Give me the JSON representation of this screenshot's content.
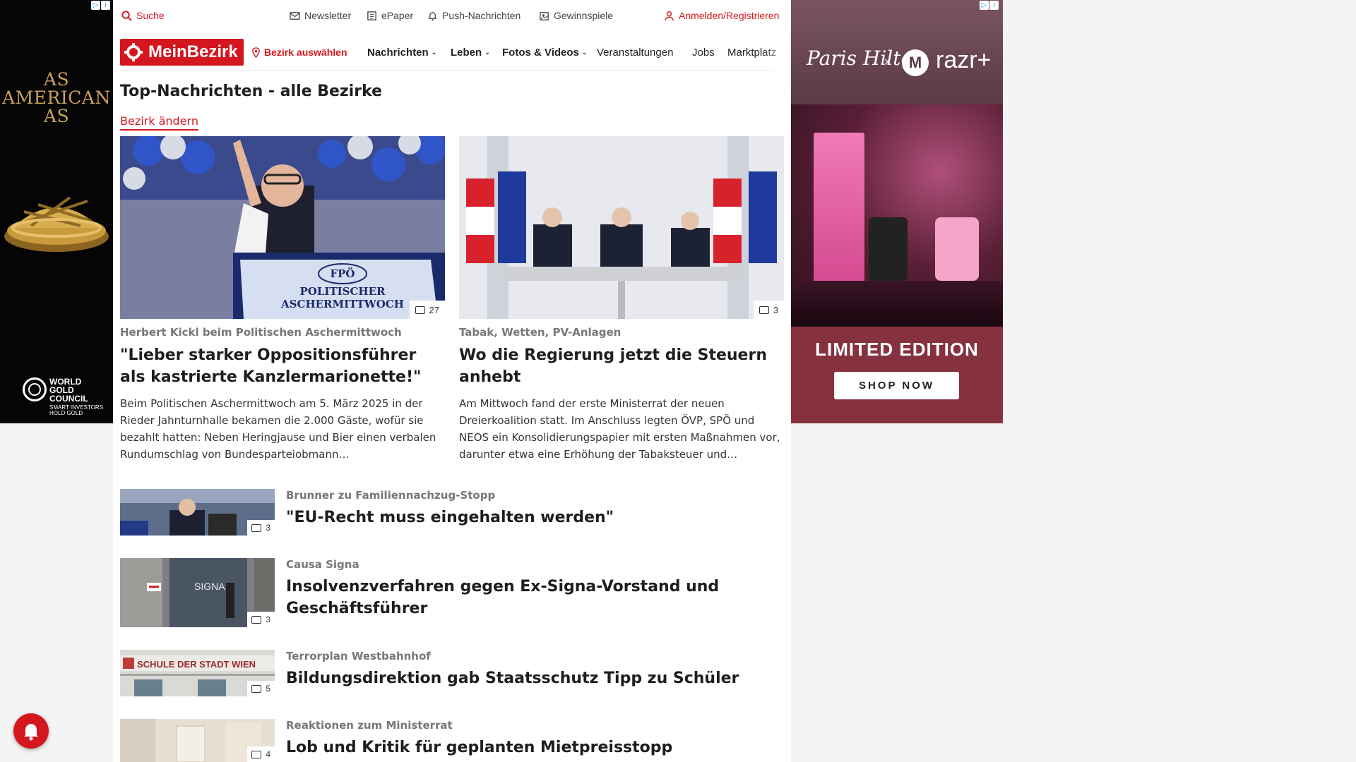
{
  "ad_left": {
    "headline_lines": [
      "AS",
      "AMERICAN",
      "AS"
    ],
    "brand_lines": "WORLD\nGOLD\nCOUNCIL",
    "tagline_lines": "SMART INVESTORS\nHOLD GOLD",
    "colors": {
      "background": "#050505",
      "gold": "#c9a25b"
    }
  },
  "ad_right": {
    "signature": "Paris Hilton",
    "separator": "×",
    "brand": "razr+",
    "motorola_mark": "M",
    "limited": "LIMITED EDITION",
    "cta": "SHOP NOW",
    "colors": {
      "bottom": "#86323e",
      "top": "#6a4450"
    }
  },
  "topbar": {
    "search": "Suche",
    "newsletter": "Newsletter",
    "epaper": "ePaper",
    "push": "Push-Nachrichten",
    "contests": "Gewinnspiele",
    "login": "Anmelden/Registrieren"
  },
  "nav": {
    "logo": "MeinBezirk",
    "select_district": "Bezirk auswählen",
    "items": [
      "Nachrichten",
      "Leben",
      "Fotos & Videos",
      "Veranstaltungen",
      "Jobs",
      "Marktplatz"
    ]
  },
  "main": {
    "title": "Top-Nachrichten - alle Bezirke",
    "change_district": "Bezirk ändern",
    "featured": [
      {
        "kicker": "Herbert Kickl beim Politischen Aschermittwoch",
        "headline": "\"Lieber starker Oppositionsführer als kastrierte Kanzlermarionette!\"",
        "teaser": "Beim Politischen Aschermittwoch am 5. März 2025 in der Rieder Jahnturnhalle bekamen die 2.000 Gäste, wofür sie bezahlt hatten: Neben Heringjause und Bier einen verbalen Rundumschlag von Bundesparteiobmann…",
        "photo_count": "27",
        "image_text": "FPÖ\nPOLITISCHER\nASCHERMITTWOCH"
      },
      {
        "kicker": "Tabak, Wetten, PV-Anlagen",
        "headline": "Wo die Regierung jetzt die Steuern anhebt",
        "teaser": "Am Mittwoch fand der erste Ministerrat der neuen Dreierkoalition statt. Im Anschluss legten ÖVP, SPÖ und NEOS ein Konsolidierungspapier mit ersten Maßnahmen vor, darunter etwa eine Erhöhung der Tabaksteuer und…",
        "photo_count": "3"
      }
    ],
    "list": [
      {
        "kicker": "Brunner zu Familiennachzug-Stopp",
        "headline": "\"EU-Recht muss eingehalten werden\"",
        "photo_count": "3"
      },
      {
        "kicker": "Causa Signa",
        "headline": "Insolvenzverfahren gegen Ex-Signa-Vorstand und Geschäftsführer",
        "photo_count": "3",
        "image_text": "SIGNA"
      },
      {
        "kicker": "Terrorplan Westbahnhof",
        "headline": "Bildungsdirektion gab Staatsschutz Tipp zu Schüler",
        "photo_count": "5",
        "image_text": "SCHULE DER STADT WIEN"
      },
      {
        "kicker": "Reaktionen zum Ministerrat",
        "headline": "Lob und Kritik für geplanten Mietpreisstopp",
        "photo_count": "4"
      }
    ]
  },
  "colors": {
    "brand_red": "#d4171e",
    "kicker_gray": "#777777"
  }
}
